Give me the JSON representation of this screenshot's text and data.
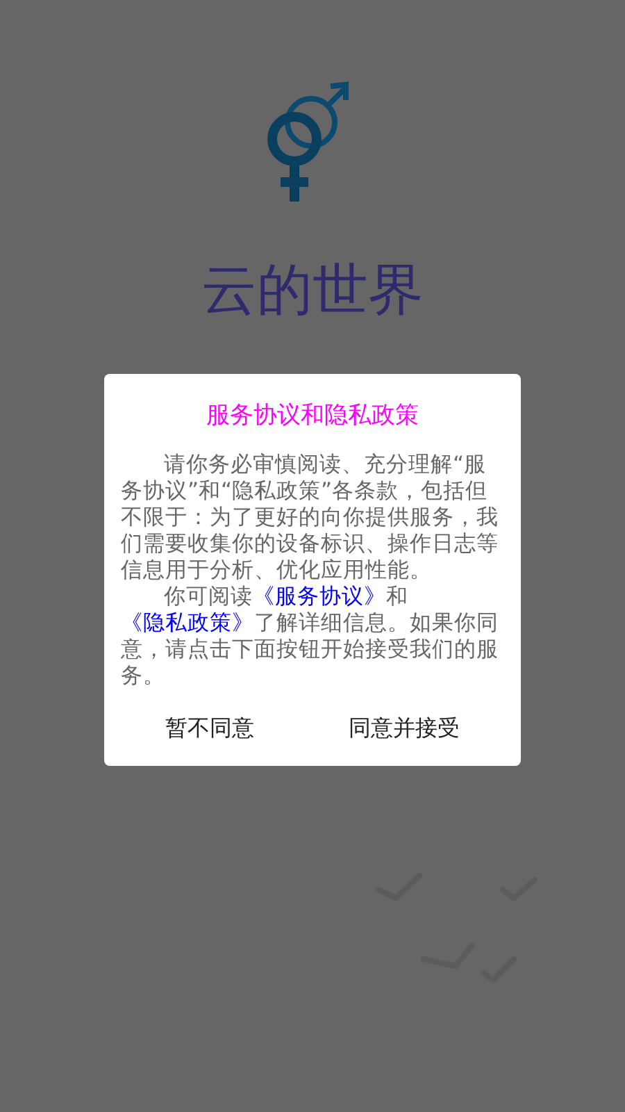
{
  "app": {
    "title": "云的世界"
  },
  "dialog": {
    "title": "服务协议和隐私政策",
    "paragraphs": [
      {
        "segments": [
          {
            "kind": "text",
            "text": "请你务必审慎阅读、充分理解“服务协议”和“隐私政策”各条款，包括但不限于：为了更好的向你提供服务，我们需要收集你的设备标识、操作日志等信息用于分析、优化应用性能。"
          }
        ]
      },
      {
        "segments": [
          {
            "kind": "text",
            "text": "你可阅读"
          },
          {
            "kind": "link",
            "text": "《服务协议》"
          },
          {
            "kind": "text",
            "text": "和"
          },
          {
            "kind": "link",
            "text": "《隐私政策》"
          },
          {
            "kind": "text",
            "text": "了解详细信息。如果你同意，请点击下面按钮开始接受我们的服务。"
          }
        ]
      }
    ],
    "buttons": [
      "暂不同意",
      "同意并接受"
    ]
  }
}
